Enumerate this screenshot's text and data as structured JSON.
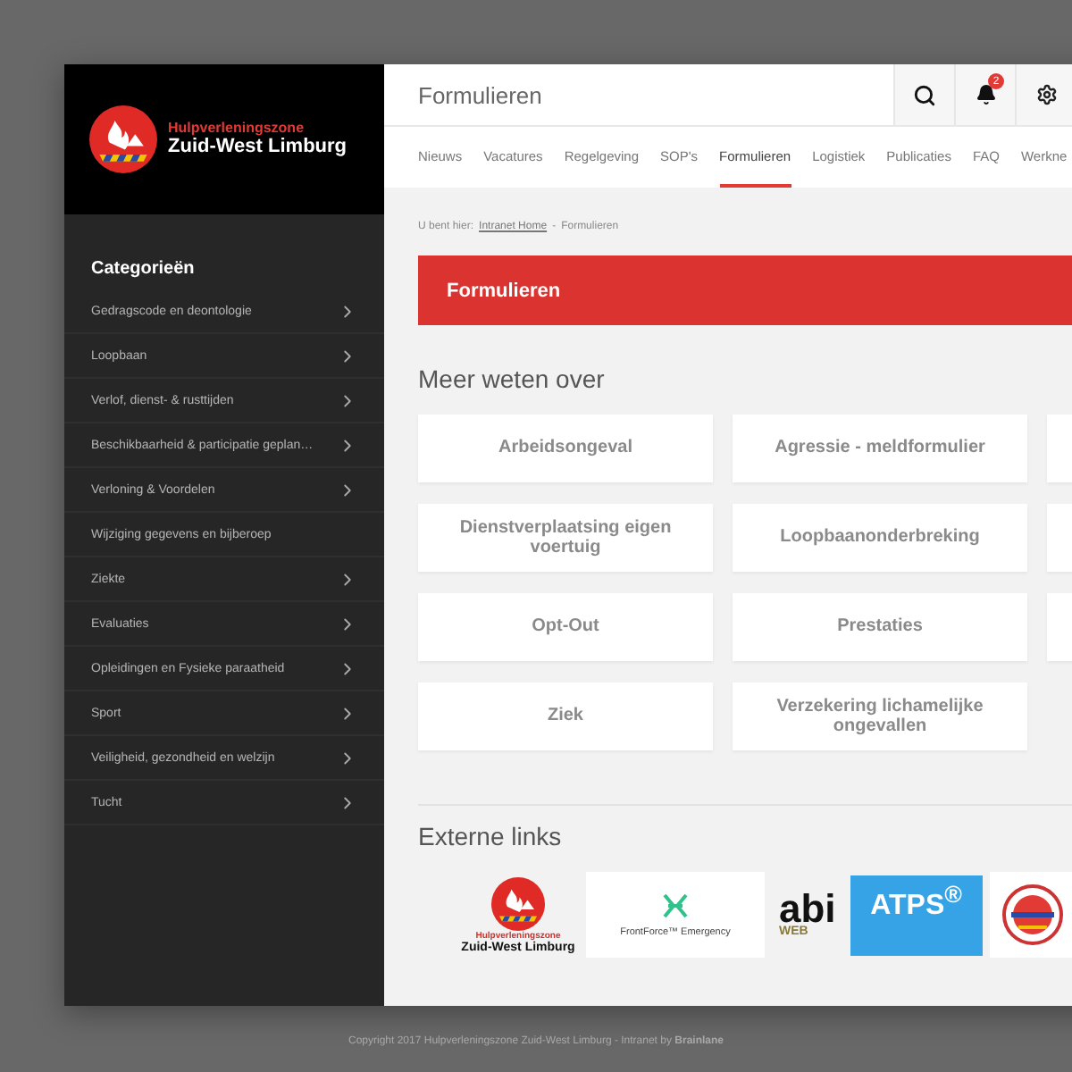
{
  "sidebar": {
    "logo": {
      "line_1": "Hulpverleningszone",
      "line_2": "Zuid-West Limburg"
    },
    "heading": "Categorieën",
    "items": [
      {
        "label": "Gedragscode en deontologie",
        "has_submenu": true
      },
      {
        "label": "Loopbaan",
        "has_submenu": true
      },
      {
        "label": "Verlof, dienst- & rusttijden",
        "has_submenu": true
      },
      {
        "label": "Beschikbaarheid & participatie geplan…",
        "has_submenu": true
      },
      {
        "label": "Verloning & Voordelen",
        "has_submenu": true
      },
      {
        "label": "Wijziging gegevens en bijberoep",
        "has_submenu": false
      },
      {
        "label": "Ziekte",
        "has_submenu": true
      },
      {
        "label": "Evaluaties",
        "has_submenu": true
      },
      {
        "label": "Opleidingen en Fysieke paraatheid",
        "has_submenu": true
      },
      {
        "label": "Sport",
        "has_submenu": true
      },
      {
        "label": "Veiligheid, gezondheid en welzijn",
        "has_submenu": true
      },
      {
        "label": "Tucht",
        "has_submenu": true
      }
    ]
  },
  "header": {
    "title": "Formulieren",
    "notification_count": "2"
  },
  "nav": [
    {
      "label": "Nieuws",
      "selected": false
    },
    {
      "label": "Vacatures",
      "selected": false
    },
    {
      "label": "Regelgeving",
      "selected": false
    },
    {
      "label": "SOP's",
      "selected": false
    },
    {
      "label": "Formulieren",
      "selected": true
    },
    {
      "label": "Logistiek",
      "selected": false
    },
    {
      "label": "Publicaties",
      "selected": false
    },
    {
      "label": "FAQ",
      "selected": false
    },
    {
      "label": "Werkne",
      "selected": false
    }
  ],
  "breadcrumb": [
    {
      "label": "U bent hier:",
      "kind": "prefix"
    },
    {
      "label": "Intranet Home",
      "kind": "link"
    },
    {
      "label": "-",
      "kind": "separator"
    },
    {
      "label": "Formulieren",
      "kind": "current"
    }
  ],
  "banner": {
    "title": "Formulieren"
  },
  "section": {
    "title": "Meer weten over",
    "cards": [
      {
        "kind": "link",
        "label": "Arbeidsongeval"
      },
      {
        "kind": "link",
        "label": "Agressie - meldformulier"
      },
      {
        "kind": "blank"
      },
      {
        "kind": "link",
        "label": "Dienstverplaatsing eigen voertuig"
      },
      {
        "kind": "link",
        "label": "Loopbaanonderbreking"
      },
      {
        "kind": "blank"
      },
      {
        "kind": "link",
        "label": "Opt-Out"
      },
      {
        "kind": "link",
        "label": "Prestaties"
      },
      {
        "kind": "blank"
      },
      {
        "kind": "link",
        "label": "Ziek"
      },
      {
        "kind": "link",
        "label": "Verzekering lichamelijke ongevallen"
      }
    ]
  },
  "external_links": {
    "title": "Externe links",
    "logos": [
      {
        "kind": "hzwl",
        "line_1": "Hulpverleningszone",
        "line_2": "Zuid-West Limburg"
      },
      {
        "kind": "frontforce",
        "label": "FrontForce™ Emergency"
      },
      {
        "kind": "abi",
        "line_1": "abi",
        "line_2": "WEB"
      },
      {
        "kind": "atps",
        "label": "ATPS$^{®}$"
      },
      {
        "kind": "badge"
      }
    ]
  },
  "footer": {
    "text": "Copyright 2017 Hulpverleningszone Zuid-West Limburg - Intranet by **Brainlane**"
  }
}
